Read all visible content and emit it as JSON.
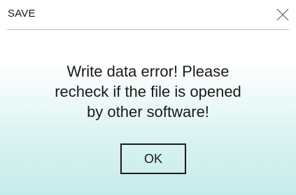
{
  "dialog": {
    "title": "SAVE",
    "close_icon": "close-x-icon",
    "message_lines": [
      "Write data error! Please",
      "recheck if the file is opened",
      "by other software!"
    ],
    "ok_label": "OK"
  }
}
